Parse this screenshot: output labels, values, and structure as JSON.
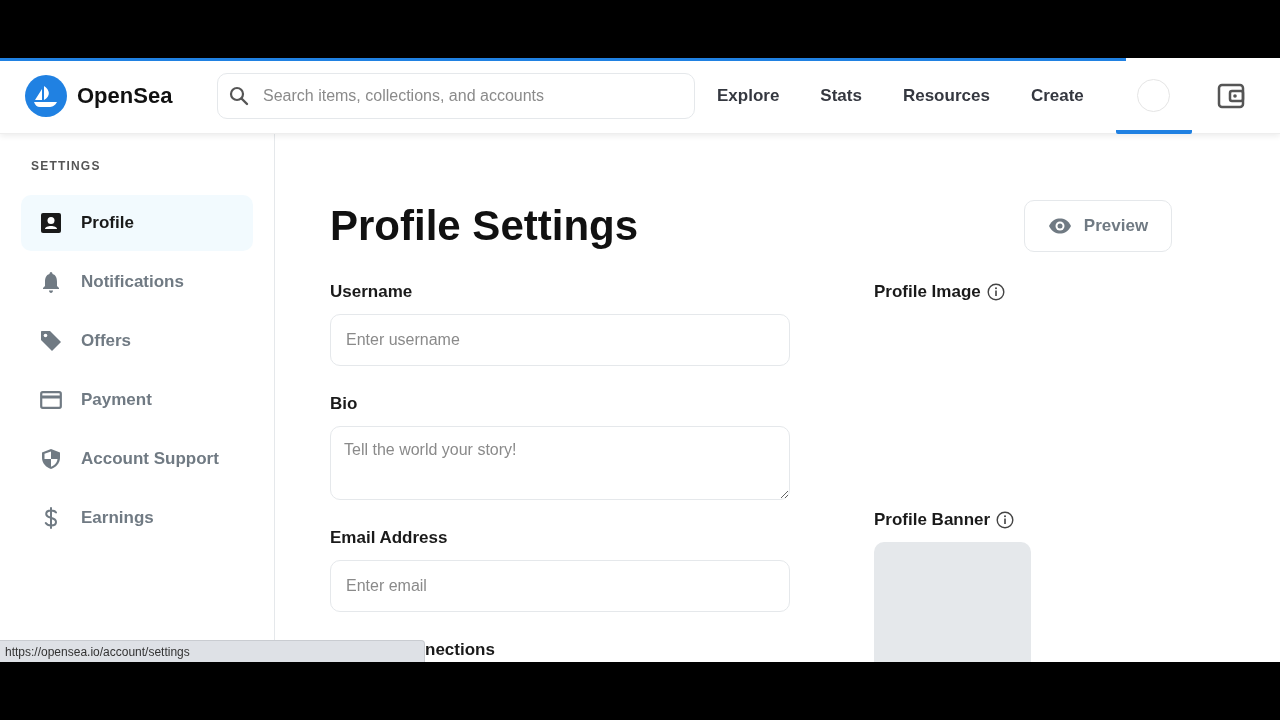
{
  "loading_bar": {
    "level": 0.88
  },
  "header": {
    "logo": "OpenSea",
    "search": {
      "placeholder": "Search items, collections, and accounts"
    },
    "nav": [
      {
        "label": "Explore"
      },
      {
        "label": "Stats"
      },
      {
        "label": "Resources"
      },
      {
        "label": "Create"
      }
    ],
    "account_tab": {
      "selected": true
    }
  },
  "sidebar": {
    "heading": "SETTINGS",
    "items": [
      {
        "label": "Profile",
        "selected": true
      },
      {
        "label": "Notifications",
        "selected": false
      },
      {
        "label": "Offers",
        "selected": false
      },
      {
        "label": "Payment",
        "selected": false
      },
      {
        "label": "Account Support",
        "selected": false
      },
      {
        "label": "Earnings",
        "selected": false
      }
    ]
  },
  "main": {
    "title": "Profile Settings",
    "preview_button": "Preview",
    "fields": [
      {
        "label": "Username",
        "kind": "input",
        "placeholder": "Enter username"
      },
      {
        "label": "Bio",
        "kind": "textarea",
        "placeholder": "Tell the world your story!"
      },
      {
        "label": "Email Address",
        "kind": "input",
        "placeholder": "Enter email"
      }
    ],
    "cut_heading": "nections",
    "profile_image": {
      "label": "Profile Image"
    },
    "profile_banner": {
      "label": "Profile Banner"
    }
  },
  "status_url": "https://opensea.io/account/settings"
}
